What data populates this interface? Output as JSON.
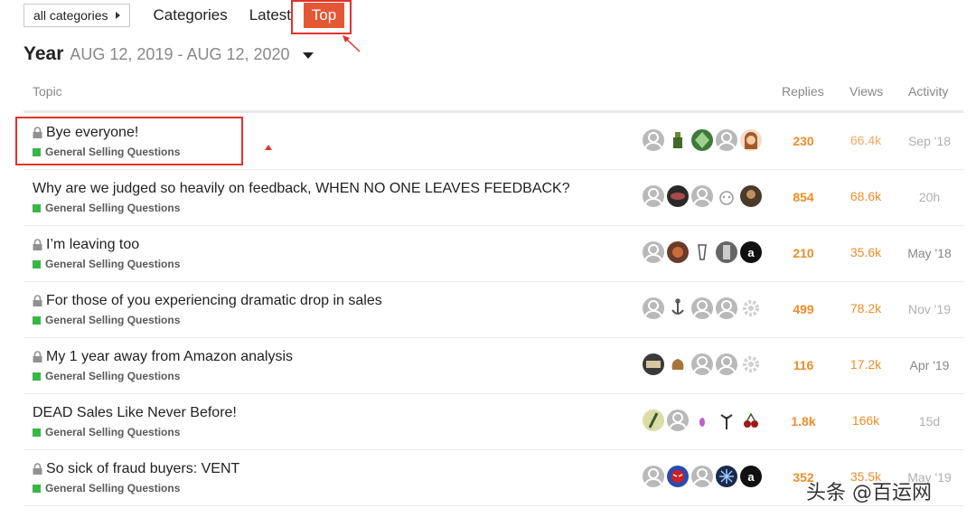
{
  "nav": {
    "category_dropdown": "all categories",
    "categories": "Categories",
    "latest": "Latest",
    "top": "Top"
  },
  "period": {
    "label": "Year",
    "range": "AUG 12, 2019 - AUG 12, 2020"
  },
  "table": {
    "headers": {
      "topic": "Topic",
      "replies": "Replies",
      "views": "Views",
      "activity": "Activity"
    },
    "rows": [
      {
        "title": "Bye everyone!",
        "locked": true,
        "category": "General Selling Questions",
        "replies": "230",
        "views": "66.4k",
        "activity": "Sep '18"
      },
      {
        "title": "Why are we judged so heavily on feedback, WHEN NO ONE LEAVES FEEDBACK?",
        "locked": false,
        "category": "General Selling Questions",
        "replies": "854",
        "views": "68.6k",
        "activity": "20h"
      },
      {
        "title": "I’m leaving too",
        "locked": true,
        "category": "General Selling Questions",
        "replies": "210",
        "views": "35.6k",
        "activity": "May '18"
      },
      {
        "title": "For those of you experiencing dramatic drop in sales",
        "locked": true,
        "category": "General Selling Questions",
        "replies": "499",
        "views": "78.2k",
        "activity": "Nov '19"
      },
      {
        "title": "My 1 year away from Amazon analysis",
        "locked": true,
        "category": "General Selling Questions",
        "replies": "116",
        "views": "17.2k",
        "activity": "Apr '19"
      },
      {
        "title": "DEAD Sales Like Never Before!",
        "locked": false,
        "category": "General Selling Questions",
        "replies": "1.8k",
        "views": "166k",
        "activity": "15d"
      },
      {
        "title": "So sick of fraud buyers: VENT",
        "locked": true,
        "category": "General Selling Questions",
        "replies": "352",
        "views": "35.5k",
        "activity": "May '19"
      }
    ]
  },
  "watermark": "头条 @百运网",
  "colors": {
    "accent": "#e45735",
    "highlight": "#e0332c",
    "category": "#3ab54a",
    "count": "#f08c2a"
  }
}
